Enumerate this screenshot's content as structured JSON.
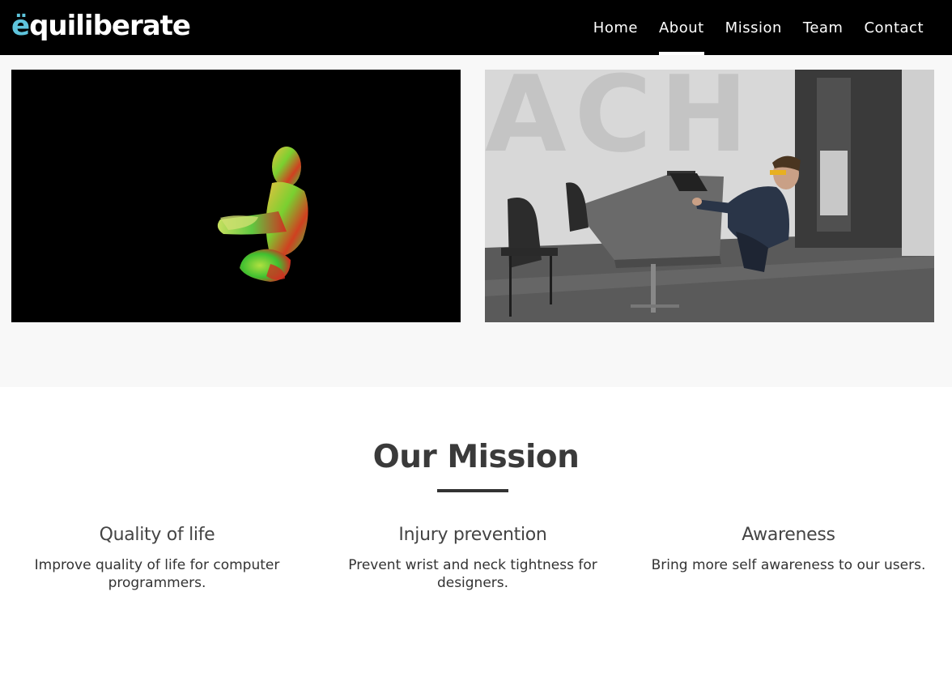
{
  "brand": {
    "logo_first": "ë",
    "logo_rest": "quiliberate",
    "accent_color": "#5ec4dc"
  },
  "nav": {
    "items": [
      {
        "label": "Home"
      },
      {
        "label": "About"
      },
      {
        "label": "Mission"
      },
      {
        "label": "Team"
      },
      {
        "label": "Contact"
      }
    ],
    "active": "About"
  },
  "gallery": {
    "images": [
      {
        "name": "posture-heatmap-figure"
      },
      {
        "name": "office-photo-person-at-laptop"
      }
    ]
  },
  "mission": {
    "title": "Our Mission",
    "columns": [
      {
        "heading": "Quality of life",
        "text": "Improve quality of life for computer programmers."
      },
      {
        "heading": "Injury prevention",
        "text": "Prevent wrist and neck tightness for designers."
      },
      {
        "heading": "Awareness",
        "text": "Bring more self awareness to our users."
      }
    ]
  }
}
